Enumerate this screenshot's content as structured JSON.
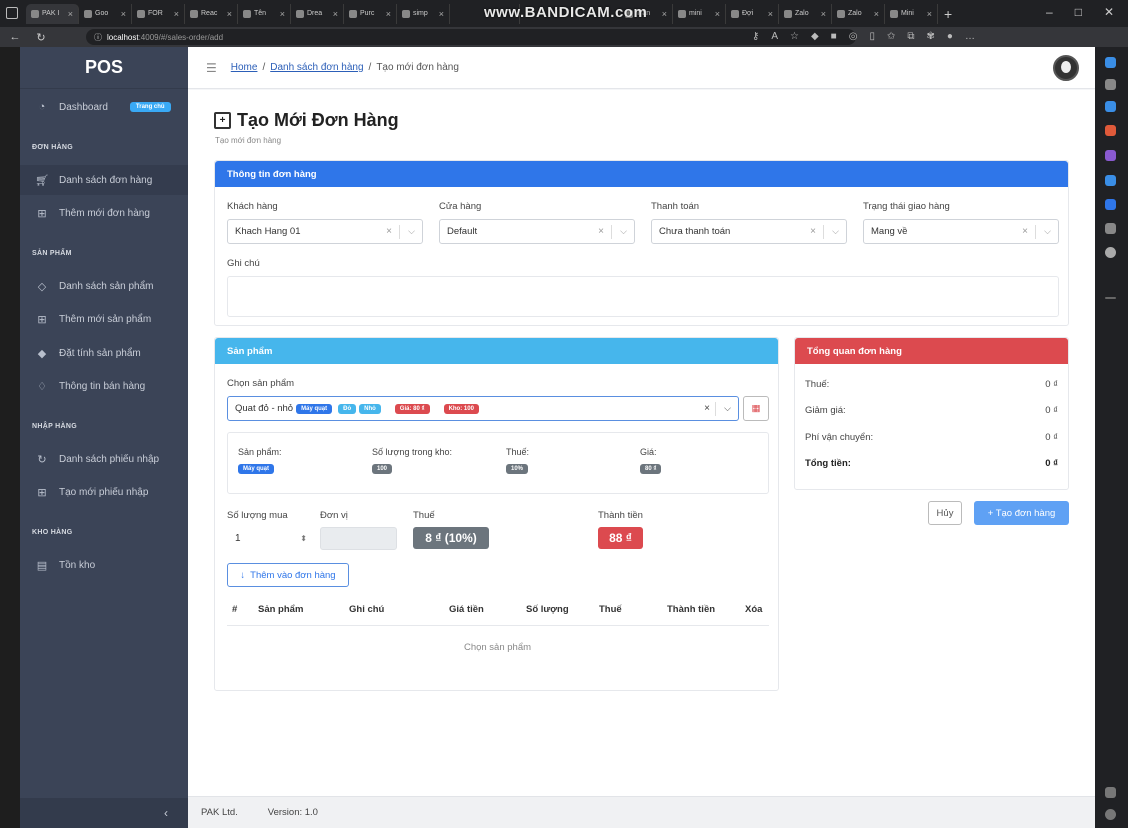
{
  "browser": {
    "tabs": [
      "PAK I",
      "Goo",
      "FOR",
      "Reac",
      "Tên",
      "Drea",
      "Purc",
      "simp",
      "",
      "Tran",
      "mini",
      "Đợi",
      "Zalo",
      "Zalo",
      "Mini"
    ],
    "watermark": "www.BANDICAM.com",
    "url_host": "localhost",
    "url_path": ":4009/#/sales-order/add"
  },
  "sidebar": {
    "brand": "POS",
    "dashboard": "Dashboard",
    "dashboard_badge": "Trang chủ",
    "sections": {
      "orders": "ĐƠN HÀNG",
      "products": "SẢN PHẨM",
      "imports": "NHẬP HÀNG",
      "warehouse": "KHO HÀNG"
    },
    "items": {
      "order_list": "Danh sách đơn hàng",
      "order_add": "Thêm mới đơn hàng",
      "product_list": "Danh sách sản phẩm",
      "product_add": "Thêm mới sản phẩm",
      "product_attr": "Đặt tính sản phẩm",
      "sale_info": "Thông tin bán hàng",
      "import_list": "Danh sách phiếu nhập",
      "import_add": "Tạo mới phiếu nhập",
      "stock": "Tồn kho"
    },
    "collapse": "‹"
  },
  "breadcrumb": {
    "home": "Home",
    "orders": "Danh sách đơn hàng",
    "current": "Tạo mới đơn hàng",
    "sep": "/"
  },
  "page": {
    "title": "Tạo Mới Đơn Hàng",
    "subtitle": "Tạo mới đơn hàng"
  },
  "order_info": {
    "header": "Thông tin đơn hàng",
    "customer_label": "Khách hàng",
    "customer_value": "Khach Hang 01",
    "store_label": "Cửa hàng",
    "store_value": "Default",
    "payment_label": "Thanh toán",
    "payment_value": "Chưa thanh toán",
    "delivery_label": "Trạng thái giao hàng",
    "delivery_value": "Mang về",
    "note_label": "Ghi chú"
  },
  "product": {
    "header": "Sản phẩm",
    "select_label": "Chọn sản phẩm",
    "selected_name": "Quat đỏ - nhỏ",
    "selected_tags": {
      "category": "Máy quạt",
      "color": "Đỏ",
      "size": "Nhỏ",
      "price": "Giá: 80 ₫",
      "stock": "Kho: 100"
    },
    "detail": {
      "product_label": "Sản phẩm:",
      "product_value": "Máy quạt",
      "stock_label": "Số lượng trong kho:",
      "stock_value": "100",
      "tax_label": "Thuế:",
      "tax_value": "10%",
      "price_label": "Giá:",
      "price_value": "80 ₫"
    },
    "qty_label": "Số lượng mua",
    "qty_value": "1",
    "unit_label": "Đơn vị",
    "tax_label": "Thuế",
    "tax_value": "8 ₫ (10%)",
    "total_label": "Thành tiền",
    "total_value": "88 ₫",
    "add_button": "Thêm vào đơn hàng",
    "table_headers": [
      "#",
      "Sản phẩm",
      "Ghi chú",
      "Giá tiền",
      "Số lượng",
      "Thuế",
      "Thành tiền",
      "Xóa"
    ],
    "table_empty": "Chọn sản phẩm"
  },
  "summary": {
    "header": "Tổng quan đơn hàng",
    "tax_label": "Thuế:",
    "tax_value": "0 ₫",
    "discount_label": "Giảm giá:",
    "discount_value": "0 ₫",
    "shipping_label": "Phí vận chuyển:",
    "shipping_value": "0 ₫",
    "total_label": "Tổng tiền:",
    "total_value": "0 ₫",
    "cancel_button": "Hủy",
    "create_button": "+ Tạo đơn hàng"
  },
  "footer": {
    "company": "PAK Ltd.",
    "version": "Version: 1.0"
  }
}
